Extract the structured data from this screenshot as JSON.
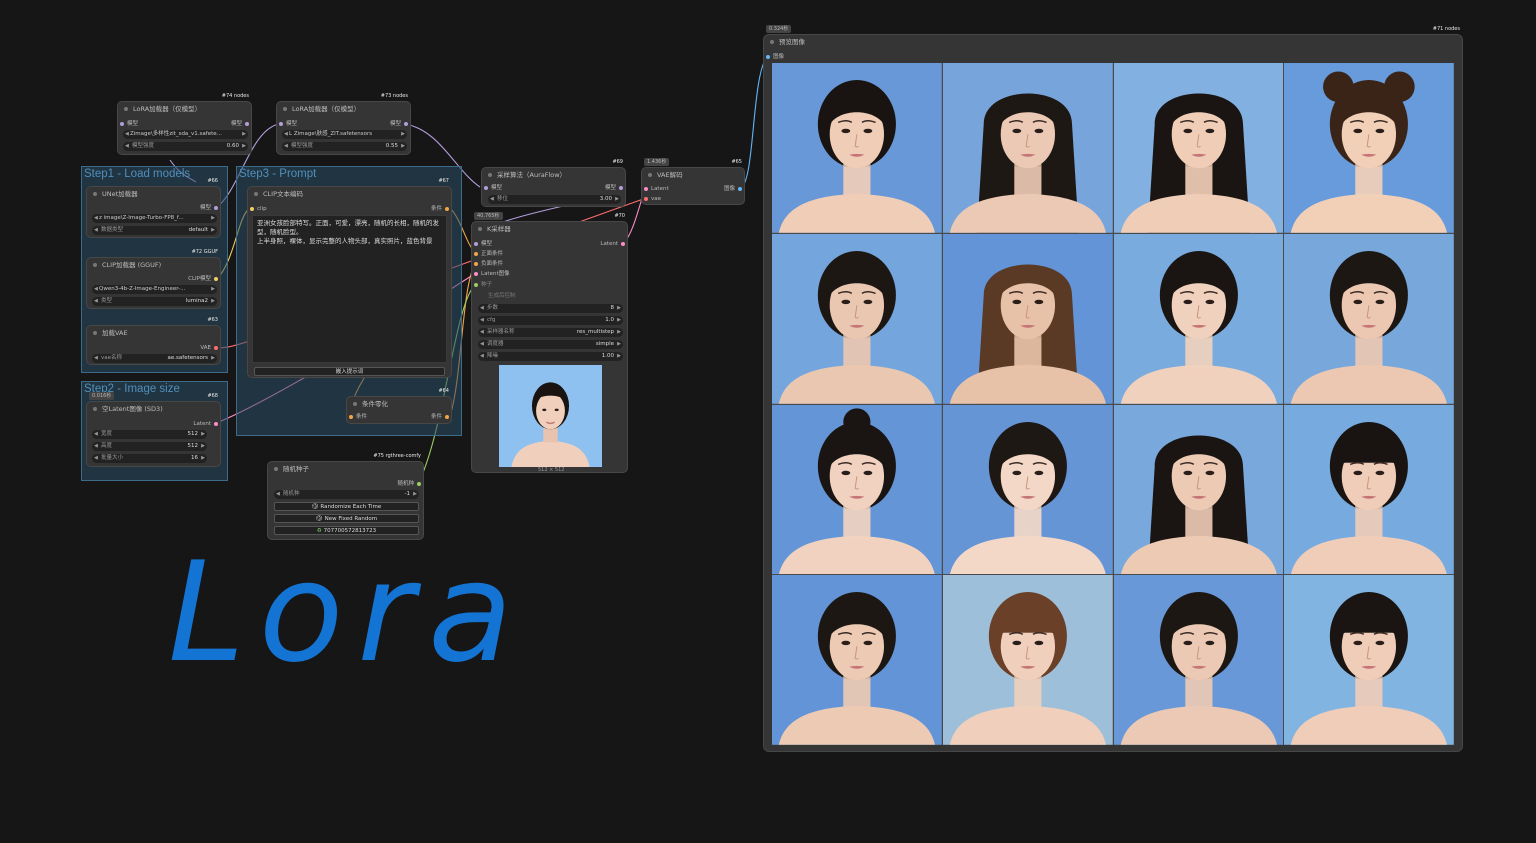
{
  "groups": {
    "step1": "Step1 - Load models",
    "step2": "Step2 - Image size",
    "step3": "Step3 - Prompt"
  },
  "lora_loader_a": {
    "badge": "#74 nodes",
    "title": "LoRA加载器（仅模型）",
    "port_in": "模型",
    "port_out": "模型",
    "lora_value": "Zimage\\多样性zit_sda_v1.safete...",
    "strength_label": "模型强度",
    "strength_value": "0.60"
  },
  "lora_loader_b": {
    "badge": "#73 nodes",
    "title": "LoRA加载器（仅模型）",
    "port_in": "模型",
    "port_out": "模型",
    "lora_value": "Zimage\\肤感_ZIT.safetensors",
    "lora_prefix": "L",
    "strength_label": "模型强度",
    "strength_value": "0.55"
  },
  "unet_loader": {
    "badge": "#66",
    "title": "UNet加载器",
    "port_out": "模型",
    "model_value": "z image\\Z-Image-Turbo-FP8_f...",
    "dtype_label": "数据类型",
    "dtype_value": "default"
  },
  "clip_loader": {
    "badge": "#72 GGUF",
    "title": "CLIP加载器 (GGUF)",
    "port_out": "CLIP模型",
    "model_value": "Qwen3-4b-Z-Image-Engineer-...",
    "type_label": "类型",
    "type_value": "lumina2"
  },
  "vae_loader": {
    "badge": "#63",
    "title": "加载VAE",
    "port_out": "VAE",
    "name_label": "vae名称",
    "name_value": "ae.safetensors"
  },
  "latent": {
    "badge": "#68",
    "timer": "0.016秒",
    "title": "空Latent图像 (SD3)",
    "port_out": "Latent",
    "width_label": "宽度",
    "width_value": "512",
    "height_label": "高度",
    "height_value": "512",
    "batch_label": "批量大小",
    "batch_value": "16"
  },
  "clip_encode": {
    "badge": "#67",
    "title": "CLIP文本编码",
    "port_in": "clip",
    "port_out": "条件",
    "prompt": "亚洲女孩脸部特写。正面，可爱，漂亮，随机的长相，随机的发型，随机脸型。\n上半身照，裸体，显示完整的人物头部，真实照片，蓝色背景",
    "button": "嵌入提示词"
  },
  "cond_zero": {
    "badge": "#64",
    "title": "条件零化",
    "port_in": "条件",
    "port_out": "条件"
  },
  "seed_node": {
    "badge": "#75 rgthree-comfy",
    "title": "随机种子",
    "port_out": "随机种",
    "seed_label": "随机种",
    "seed_value": "-1",
    "btn_randomize": "Randomize Each Time",
    "btn_fixed": "New Fixed Random",
    "btn_last": "707700572813723"
  },
  "sampling_algo": {
    "badge": "#69",
    "title": "采样算法（AuraFlow）",
    "port_in": "模型",
    "port_out": "模型",
    "shift_label": "移位",
    "shift_value": "3.00"
  },
  "ksampler": {
    "badge": "#70",
    "timer": "40.765秒",
    "title": "K采样器",
    "in_model": "模型",
    "in_pos": "正面条件",
    "in_neg": "负面条件",
    "in_latent": "Latent图像",
    "in_seed": "种子",
    "out_latent": "Latent",
    "seed_ctrl": "生成后控制",
    "steps_label": "步数",
    "steps_value": "8",
    "cfg_label": "cfg",
    "cfg_value": "1.0",
    "sampler_label": "采样器名称",
    "sampler_value": "res_multistep",
    "scheduler_label": "调度器",
    "scheduler_value": "simple",
    "denoise_label": "降噪",
    "denoise_value": "1.00",
    "preview_size": "512 × 512"
  },
  "vae_decode": {
    "badge": "#65",
    "timer": "1.436秒",
    "title": "VAE解码",
    "in_latent": "Latent",
    "in_vae": "vae",
    "port_out": "图像"
  },
  "preview": {
    "badge": "#71 nodes",
    "timer": "0.324秒",
    "title": "预览图像",
    "port_in": "图像"
  },
  "handwriting": "Lora",
  "colors": {
    "canvas_bg": "#161616",
    "group_fill": "#2c4e66",
    "group_title": "#4f8fbd",
    "node_bg": "#353535",
    "handwriting": "#1474d4",
    "model_link": "#b39ddb",
    "clip_link": "#f0d060",
    "cond_link": "#f2a44a",
    "latent_link": "#ff8cc6",
    "vae_link": "#ff6e6e",
    "image_link": "#64b5f6",
    "int_link": "#9ccc65"
  },
  "preview_images": [
    {
      "bg": "#6fa3e6",
      "hair": "#191411",
      "skin": "#f0cdb7",
      "style": "short"
    },
    {
      "bg": "#7fb0ea",
      "hair": "#1d1814",
      "skin": "#ecc9b4",
      "style": "long"
    },
    {
      "bg": "#8abcf0",
      "hair": "#1a1512",
      "skin": "#f0cdb7",
      "style": "long"
    },
    {
      "bg": "#6ea6ea",
      "hair": "#3a2418",
      "skin": "#f2d0b8",
      "style": "buns"
    },
    {
      "bg": "#7cb2ec",
      "hair": "#1c1713",
      "skin": "#eac7b0",
      "style": "short"
    },
    {
      "bg": "#6a9ee6",
      "hair": "#5a3a24",
      "skin": "#e8c2a8",
      "style": "long"
    },
    {
      "bg": "#83b7ee",
      "hair": "#1a1512",
      "skin": "#f0d1bd",
      "style": "short"
    },
    {
      "bg": "#7fb3ea",
      "hair": "#1c1713",
      "skin": "#ecc8b2",
      "style": "short"
    },
    {
      "bg": "#6b9fe6",
      "hair": "#1a1512",
      "skin": "#f1d2c0",
      "style": "bun"
    },
    {
      "bg": "#6c9fe4",
      "hair": "#1d1814",
      "skin": "#f3d8c8",
      "style": "short"
    },
    {
      "bg": "#82b4ec",
      "hair": "#1a1512",
      "skin": "#eccab4",
      "style": "long"
    },
    {
      "bg": "#7fb6ee",
      "hair": "#191411",
      "skin": "#efcdb8",
      "style": "bangs"
    },
    {
      "bg": "#6a9ee6",
      "hair": "#1c1713",
      "skin": "#eccab3",
      "style": "short"
    },
    {
      "bg": "#a9cce9",
      "hair": "#6a4128",
      "skin": "#f0d0bc",
      "style": "bangs"
    },
    {
      "bg": "#6fa3e6",
      "hair": "#1c1713",
      "skin": "#ecc9b4",
      "style": "short"
    },
    {
      "bg": "#8ac0f0",
      "hair": "#1a1512",
      "skin": "#efcdb8",
      "style": "bangs"
    }
  ]
}
